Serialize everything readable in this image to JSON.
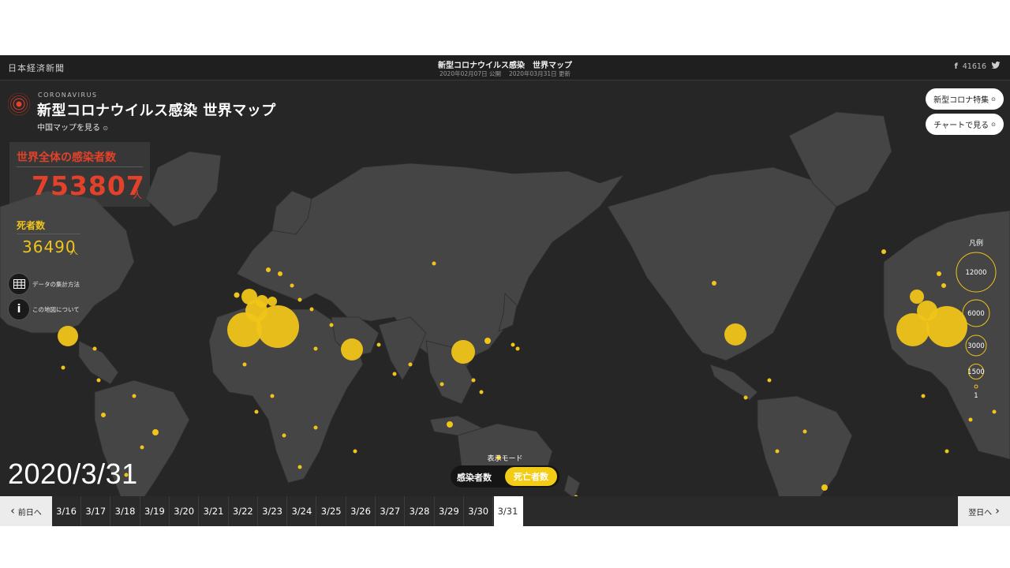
{
  "header": {
    "logo": "日本経済新聞",
    "title": "新型コロナウイルス感染　世界マップ",
    "subtitle": "2020年02月07日 公開　 2020年03月31日 更新",
    "facebook_count": "41616"
  },
  "overlay": {
    "kicker": "CORONAVIRUS",
    "title": "新型コロナウイルス感染 世界マップ",
    "china_link": "中国マップを見る",
    "cases_label": "世界全体の感染者数",
    "cases_value": "753807",
    "cases_unit": "人",
    "deaths_label": "死者数",
    "deaths_value": "36490",
    "deaths_unit": "人",
    "method_label": "データの集計方法",
    "about_label": "この地図について",
    "special_button": "新型コロナ特集",
    "chart_button": "チャートで見る",
    "legend_title": "凡例",
    "legend_values": [
      "12000",
      "6000",
      "3000",
      "1500",
      "1"
    ],
    "current_date": "2020/3/31",
    "mode_label": "表示モード",
    "mode_cases": "感染者数",
    "mode_deaths": "死亡者数"
  },
  "timeline": {
    "prev": "前日へ",
    "next": "翌日へ",
    "dates": [
      "3/16",
      "3/17",
      "3/18",
      "3/19",
      "3/20",
      "3/21",
      "3/22",
      "3/23",
      "3/24",
      "3/25",
      "3/26",
      "3/27",
      "3/28",
      "3/29",
      "3/30",
      "3/31"
    ],
    "active": "3/31"
  },
  "colors": {
    "accent_yellow": "#f0c419",
    "accent_red": "#e4412a",
    "background": "#262626"
  }
}
